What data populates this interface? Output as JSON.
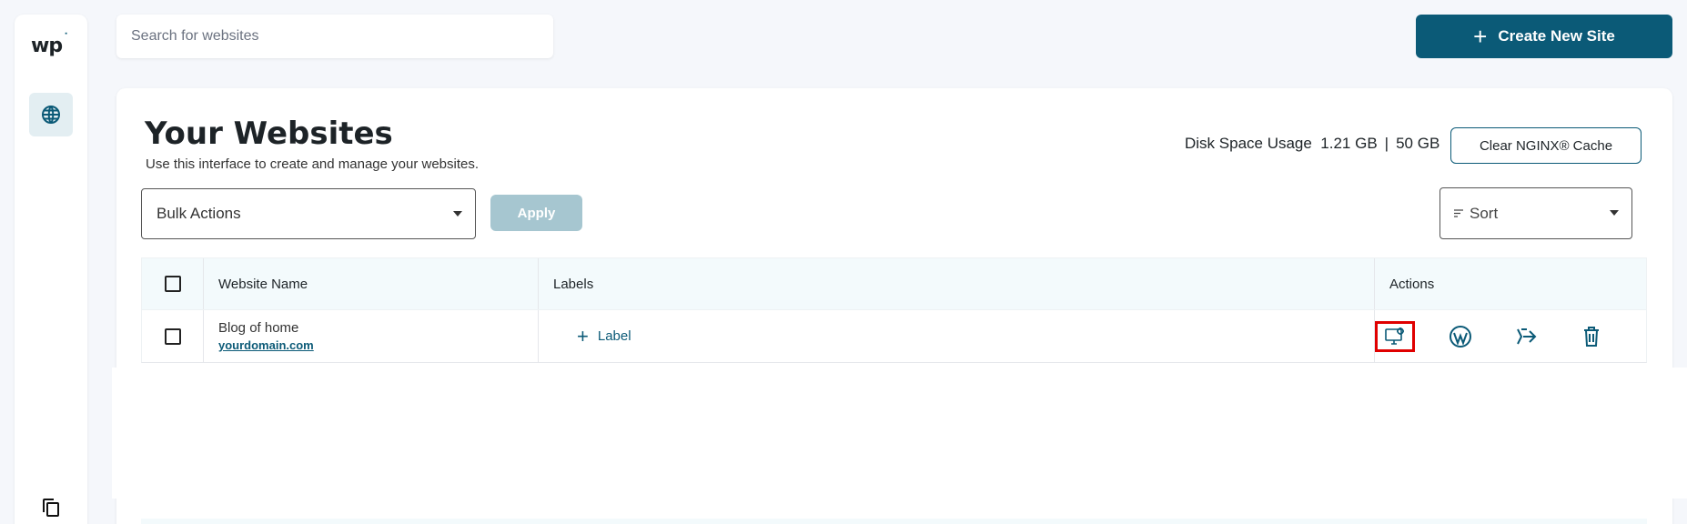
{
  "app": {
    "logo_text": "wp",
    "logo_tick": "˙",
    "search_placeholder": "Search for websites",
    "create_button": "Create New Site"
  },
  "page": {
    "title": "Your Websites",
    "subtitle": "Use this interface to create and manage your websites.",
    "disk_label": "Disk Space Usage",
    "disk_used": "1.21 GB",
    "disk_separator": "|",
    "disk_total": "50 GB",
    "clear_cache_button": "Clear NGINX® Cache",
    "bulk_actions": "Bulk Actions",
    "apply_button": "Apply",
    "sort": "Sort"
  },
  "table": {
    "headers": {
      "name": "Website Name",
      "labels": "Labels",
      "actions": "Actions"
    },
    "rows": [
      {
        "name": "Blog of home",
        "domain": "yourdomain.com",
        "add_label": "Label"
      }
    ]
  },
  "icons": [
    "globe-icon",
    "copy-icon",
    "plus-icon",
    "caret-down-icon",
    "sort-icon",
    "manage-site-icon",
    "wordpress-icon",
    "migrate-icon",
    "trash-icon"
  ],
  "colors": {
    "accent": "#0b5a77",
    "highlight": "#e00000",
    "apply_disabled": "#a6c6d0"
  }
}
